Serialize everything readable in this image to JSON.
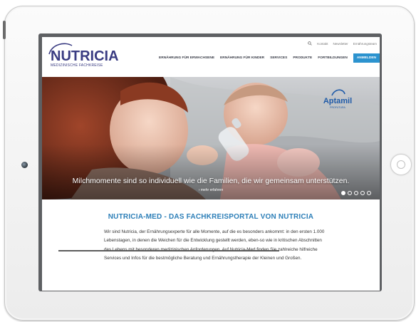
{
  "header": {
    "logo_text": "NUTRICIA",
    "logo_subtitle": "MEDIZINISCHE FACHKREISE",
    "utility_links": [
      "Kontakt",
      "Newsletter",
      "Ernährungsteam"
    ],
    "nav_items": [
      "ERNÄHRUNG FÜR ERWACHSENE",
      "ERNÄHRUNG FÜR KINDER",
      "SERVICES",
      "PRODUKTE",
      "FORTBILDUNGEN"
    ],
    "login_label": "ANMELDEN"
  },
  "hero": {
    "caption": "Milchmomente sind so individuell wie die Familien, die wir gemeinsam unterstützen.",
    "more_link": "› mehr erfahren",
    "brand_name": "Aptamil",
    "brand_subtitle": "PROFUTURA",
    "slide_count": 5,
    "active_slide": 1
  },
  "content": {
    "headline": "NUTRICIA-MED - DAS FACHKREISPORTAL VON NUTRICIA",
    "paragraph": "Wir sind Nutricia, der Ernährungsexperte für alle Momente, auf die es besonders ankommt: in den ersten 1.000 Lebenstagen, in denen die Weichen für die Entwicklung gestellt werden, eben-so wie in kritischen Abschnitten des Lebens mit besonderen medizinischen Anforderungen. Auf Nutricia-Med finden Sie zahlreiche hilfreiche Services und Infos für die bestmögliche Beratung und Ernährungstherapie der Kleinen und Großen."
  },
  "colors": {
    "brand_navy": "#3a3c82",
    "accent_blue": "#2c93cf",
    "headline_blue": "#2d7fb8"
  },
  "icons": [
    "search-icon"
  ]
}
